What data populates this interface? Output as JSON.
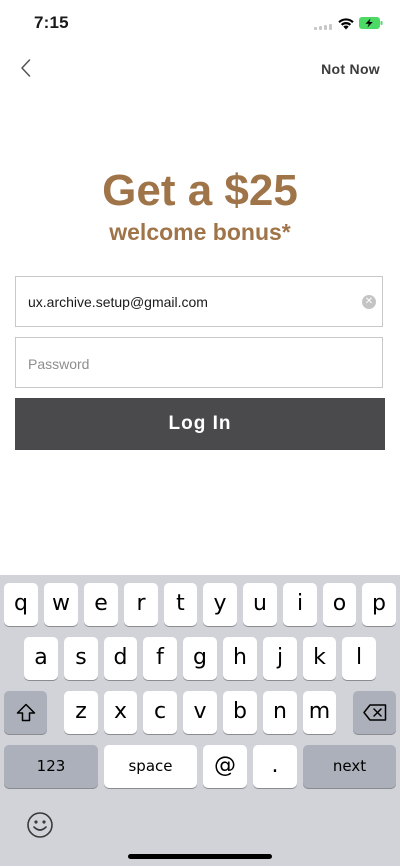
{
  "status_bar": {
    "time": "7:15"
  },
  "nav": {
    "not_now_label": "Not Now"
  },
  "promo": {
    "headline": "Get a $25",
    "subheadline": "welcome bonus*"
  },
  "form": {
    "email_value": "ux.archive.setup@gmail.com",
    "password_placeholder": "Password",
    "login_label": "Log In"
  },
  "keyboard": {
    "row1": [
      "q",
      "w",
      "e",
      "r",
      "t",
      "y",
      "u",
      "i",
      "o",
      "p"
    ],
    "row2": [
      "a",
      "s",
      "d",
      "f",
      "g",
      "h",
      "j",
      "k",
      "l"
    ],
    "row3": [
      "z",
      "x",
      "c",
      "v",
      "b",
      "n",
      "m"
    ],
    "numbers_label": "123",
    "space_label": "space",
    "at_label": "@",
    "period_label": ".",
    "next_label": "next"
  },
  "colors": {
    "brand_gold": "#a07449",
    "button_dark": "#4a4a4c",
    "battery_green": "#4cd964"
  },
  "icons": [
    "back-chevron-icon",
    "wifi-icon",
    "battery-charging-icon",
    "clear-icon",
    "shift-icon",
    "backspace-icon",
    "emoji-icon"
  ]
}
